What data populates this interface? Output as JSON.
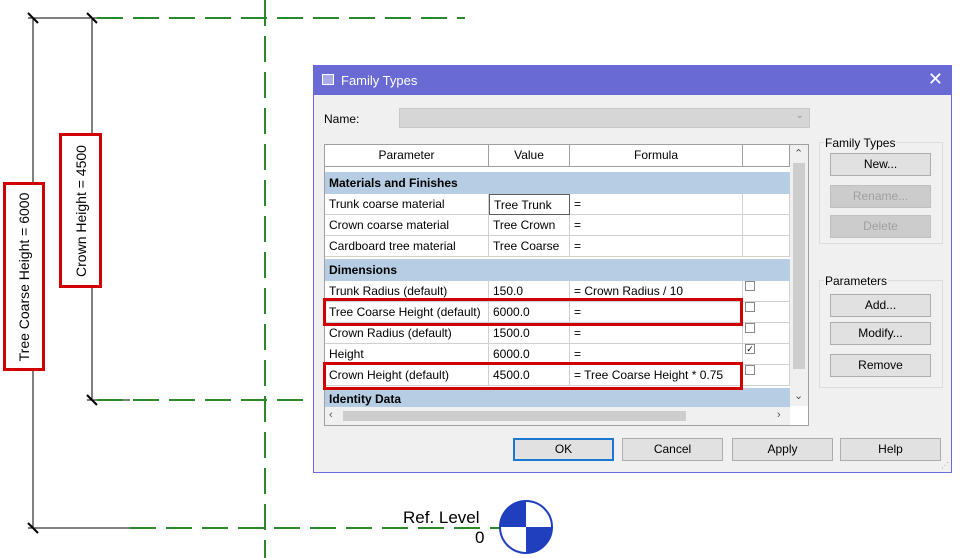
{
  "drawing": {
    "dim_tree_coarse": "Tree Coarse Height = 6000",
    "dim_crown": "Crown Height = 4500",
    "ref_level_name": "Ref. Level",
    "ref_level_value": "0",
    "colors": {
      "ref_line": "#2a8a2a",
      "highlight": "#d00000",
      "level_marker": "#1f3fbf"
    }
  },
  "dialog": {
    "title": "Family Types",
    "close_icon": "close-icon",
    "name_label": "Name:",
    "name_value": "",
    "columns": [
      "Parameter",
      "Value",
      "Formula",
      ""
    ],
    "groups": [
      {
        "label": "Materials and Finishes",
        "rows": [
          {
            "param": "Trunk coarse material",
            "value": "Tree Trunk",
            "formula": "=",
            "lock": null
          },
          {
            "param": "Crown coarse material",
            "value": "Tree Crown",
            "formula": "=",
            "lock": null
          },
          {
            "param": "Cardboard tree material",
            "value": "Tree Coarse",
            "formula": "=",
            "lock": null
          }
        ]
      },
      {
        "label": "Dimensions",
        "rows": [
          {
            "param": "Trunk Radius (default)",
            "value": "150.0",
            "formula": "= Crown Radius / 10",
            "lock": false
          },
          {
            "param": "Tree Coarse Height (default)",
            "value": "6000.0",
            "formula": "=",
            "lock": false
          },
          {
            "param": "Crown Radius (default)",
            "value": "1500.0",
            "formula": "=",
            "lock": false
          },
          {
            "param": "Height",
            "value": "6000.0",
            "formula": "=",
            "lock": true
          },
          {
            "param": "Crown Height (default)",
            "value": "4500.0",
            "formula": "= Tree Coarse Height * 0.75",
            "lock": false
          }
        ]
      },
      {
        "label": "Identity Data",
        "rows": []
      }
    ],
    "family_types_panel": {
      "title": "Family Types",
      "new_label": "New...",
      "rename_label": "Rename...",
      "delete_label": "Delete"
    },
    "parameters_panel": {
      "title": "Parameters",
      "add_label": "Add...",
      "modify_label": "Modify...",
      "remove_label": "Remove"
    },
    "footer": {
      "ok_label": "OK",
      "cancel_label": "Cancel",
      "apply_label": "Apply",
      "help_label": "Help"
    }
  }
}
